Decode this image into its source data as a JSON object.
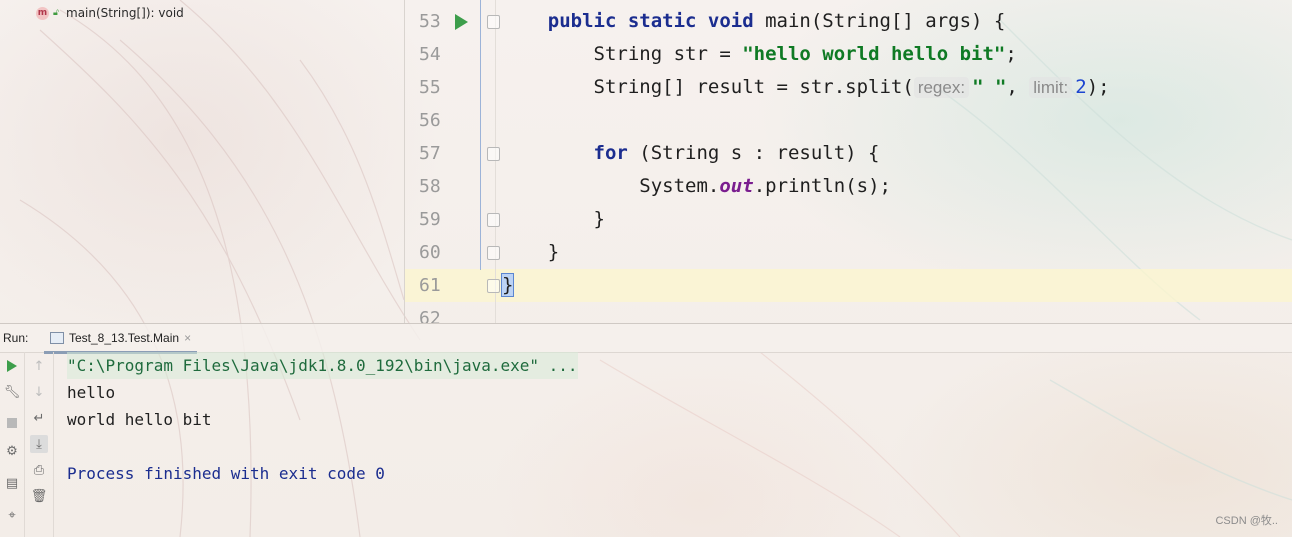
{
  "breadcrumb": {
    "method_sig": "main(String[]): void"
  },
  "gutter": {
    "line_numbers": [
      "53",
      "54",
      "55",
      "56",
      "57",
      "58",
      "59",
      "60",
      "61",
      "62"
    ]
  },
  "code": {
    "l53": {
      "kw": "public static void",
      "rest": " main(String[] args) {"
    },
    "l54": {
      "pre": "String str = ",
      "str": "\"hello world hello bit\"",
      "post": ";"
    },
    "l55": {
      "pre": "String[] result = str.split(",
      "hint1": "regex:",
      "str": "\" \"",
      "mid": ", ",
      "hint2": "limit:",
      "num": "2",
      "post": ");"
    },
    "l57": {
      "kw": "for",
      "rest": " (String s : result) {"
    },
    "l58": {
      "pre": "System.",
      "fld": "out",
      "post": ".println(s);"
    },
    "l59": "}",
    "l60": "}",
    "l61": "}"
  },
  "run_panel": {
    "label": "Run:",
    "tab_label": "Test_8_13.Test.Main",
    "tab_close": "×"
  },
  "console": {
    "command": "\"C:\\Program Files\\Java\\jdk1.8.0_192\\bin\\java.exe\" ...",
    "out1": "hello",
    "out2": "world hello bit",
    "finish": "Process finished with exit code 0"
  },
  "watermark": "CSDN @牧..",
  "colors": {
    "keyword": "#1b2d8f",
    "string": "#0f7a24",
    "field": "#7a1d8f",
    "number": "#1c45d1",
    "run_green": "#3d9e4b"
  }
}
